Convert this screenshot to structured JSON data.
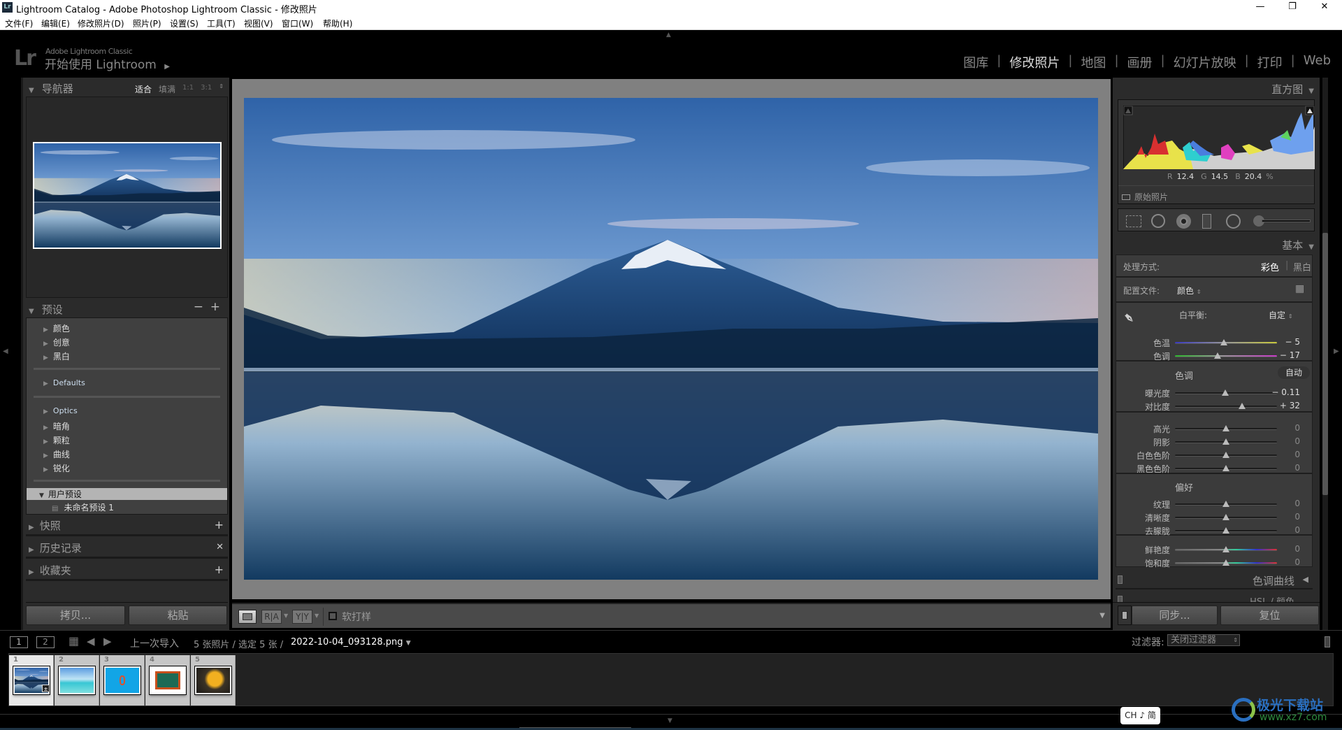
{
  "window": {
    "title": "Lightroom Catalog - Adobe Photoshop Lightroom Classic - 修改照片",
    "app_icon": "Lr"
  },
  "menu": [
    "文件(F)",
    "编辑(E)",
    "修改照片(D)",
    "照片(P)",
    "设置(S)",
    "工具(T)",
    "视图(V)",
    "窗口(W)",
    "帮助(H)"
  ],
  "identity": {
    "logo": "Lr",
    "product": "Adobe Lightroom Classic",
    "tagline": "开始使用 Lightroom"
  },
  "modules": [
    {
      "label": "图库",
      "active": false
    },
    {
      "label": "修改照片",
      "active": true
    },
    {
      "label": "地图",
      "active": false
    },
    {
      "label": "画册",
      "active": false
    },
    {
      "label": "幻灯片放映",
      "active": false
    },
    {
      "label": "打印",
      "active": false
    },
    {
      "label": "Web",
      "active": false
    }
  ],
  "left": {
    "navigator": {
      "title": "导航器",
      "zoom_options": [
        "适合",
        "填满",
        "1:1",
        "3:1"
      ],
      "active_zoom": "适合"
    },
    "presets": {
      "title": "预设",
      "groups": [
        "颜色",
        "创意",
        "黑白",
        "Defaults",
        "Optics",
        "暗角",
        "颗粒",
        "曲线",
        "锐化"
      ],
      "user_group": "用户预设",
      "user_items": [
        "未命名预设 1"
      ]
    },
    "snapshots": "快照",
    "history": "历史记录",
    "collections": "收藏夹",
    "copy_button": "拷贝...",
    "paste_button": "粘贴"
  },
  "toolbar": {
    "view_loupe": "loupe",
    "before_after_ra": "R|A",
    "before_after_yy": "Y|Y",
    "soft_proof_label": "软打样",
    "soft_proof_checked": false
  },
  "right": {
    "histogram": {
      "title": "直方图",
      "r_label": "R",
      "r": "12.4",
      "g_label": "G",
      "g": "14.5",
      "b_label": "B",
      "b": "20.4",
      "unit": "%",
      "original_label": "原始照片"
    },
    "basic": {
      "title": "基本",
      "treatment_label": "处理方式:",
      "treatment_color": "彩色",
      "treatment_bw": "黑白",
      "profile_label": "配置文件:",
      "profile_value": "颜色",
      "wb_label": "白平衡:",
      "wb_value": "自定",
      "tone_label": "色调",
      "auto_label": "自动",
      "presence_label": "偏好",
      "sliders": [
        {
          "label": "色温",
          "value": "− 5",
          "position": 0.48,
          "group": "wb",
          "gradient": "temp"
        },
        {
          "label": "色调",
          "value": "− 17",
          "position": 0.42,
          "group": "wb",
          "gradient": "tint"
        },
        {
          "label": "曝光度",
          "value": "− 0.11",
          "position": 0.49,
          "group": "tone1"
        },
        {
          "label": "对比度",
          "value": "+ 32",
          "position": 0.66,
          "group": "tone1"
        },
        {
          "label": "高光",
          "value": "0",
          "position": 0.5,
          "group": "tone2"
        },
        {
          "label": "阴影",
          "value": "0",
          "position": 0.5,
          "group": "tone2"
        },
        {
          "label": "白色色阶",
          "value": "0",
          "position": 0.5,
          "group": "tone2"
        },
        {
          "label": "黑色色阶",
          "value": "0",
          "position": 0.5,
          "group": "tone2"
        },
        {
          "label": "纹理",
          "value": "0",
          "position": 0.5,
          "group": "presence"
        },
        {
          "label": "清晰度",
          "value": "0",
          "position": 0.5,
          "group": "presence"
        },
        {
          "label": "去朦胧",
          "value": "0",
          "position": 0.5,
          "group": "presence"
        },
        {
          "label": "鲜艳度",
          "value": "0",
          "position": 0.5,
          "group": "sat",
          "gradient": "sat"
        },
        {
          "label": "饱和度",
          "value": "0",
          "position": 0.5,
          "group": "sat",
          "gradient": "sat"
        }
      ]
    },
    "tone_curve": "色调曲线",
    "hsl": "HSL / 颜色",
    "sync_button": "同步...",
    "reset_button": "复位"
  },
  "filmstrip": {
    "view1": "1",
    "view2": "2",
    "source": "上一次导入",
    "count_text": "5 张照片 / 选定 5 张 /",
    "filename": "2022-10-04_093128.png",
    "filter_label": "过滤器:",
    "filter_value": "关闭过滤器",
    "thumbs": [
      {
        "num": "1",
        "selected": true
      },
      {
        "num": "2",
        "selected": false
      },
      {
        "num": "3",
        "selected": false
      },
      {
        "num": "4",
        "selected": false
      },
      {
        "num": "5",
        "selected": false
      }
    ]
  },
  "ime": "CH ♪ 简",
  "watermark": {
    "name": "极光下载站",
    "url": "www.xz7.com"
  }
}
